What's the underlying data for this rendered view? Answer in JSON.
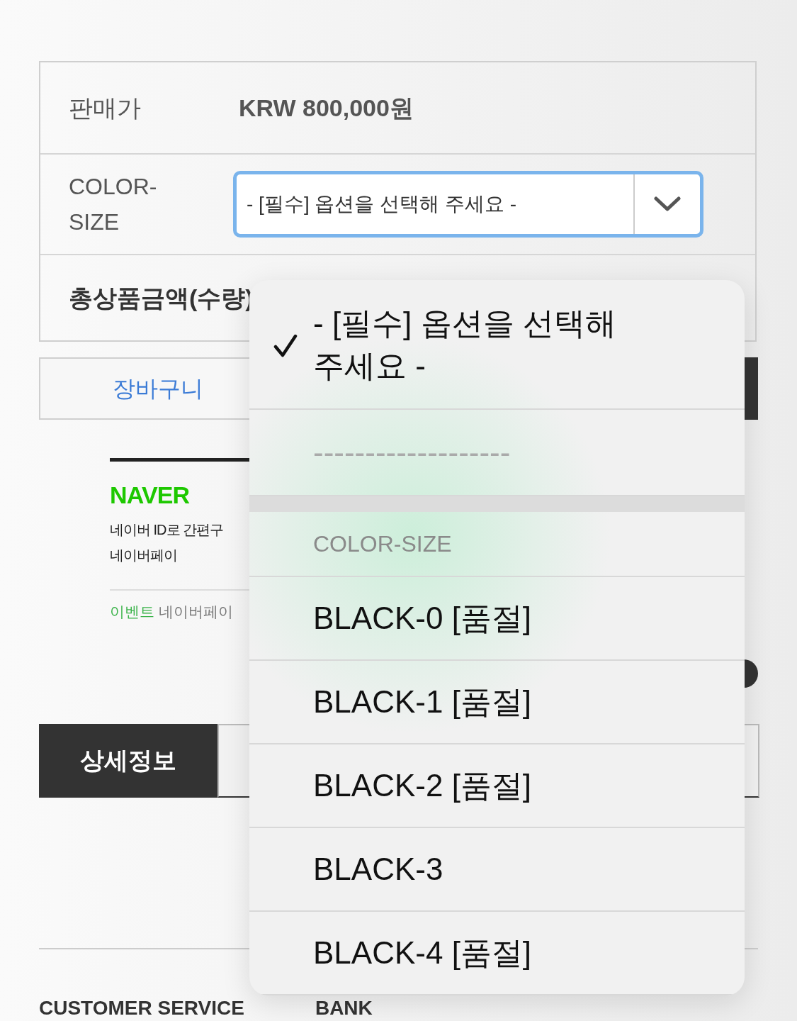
{
  "product_info": {
    "price_label": "판매가",
    "price": "KRW 800,000원",
    "option_label": "COLOR-SIZE",
    "select": {
      "value": "- [필수] 옵션을 선택해 주세요 -",
      "focused": true
    },
    "total_label": "총상품금액(수량)"
  },
  "actions": {
    "cart": "장바구니"
  },
  "naver_pay": {
    "logo": "NAVER",
    "lines": [
      "네이버 ID로 간편구",
      "네이버페이"
    ],
    "event_tag": "이벤트",
    "event_text": "네이버페이"
  },
  "tabs": [
    {
      "label": "상세정보",
      "selected": true
    },
    {
      "selected": false
    }
  ],
  "footer": [
    "CUSTOMER SERVICE",
    "BANK"
  ],
  "dropdown": {
    "items": [
      {
        "kind": "option",
        "label": "- [필수] 옵션을 선택해 주세요 -",
        "selected": true,
        "disabled": false
      },
      {
        "kind": "option",
        "label": "-------------------",
        "selected": false,
        "disabled": true
      },
      {
        "kind": "divider"
      },
      {
        "kind": "group",
        "label": "COLOR-SIZE"
      },
      {
        "kind": "option",
        "label": "BLACK-0 [품절]",
        "selected": false,
        "disabled": false
      },
      {
        "kind": "option",
        "label": "BLACK-1 [품절]",
        "selected": false,
        "disabled": false
      },
      {
        "kind": "option",
        "label": "BLACK-2 [품절]",
        "selected": false,
        "disabled": false
      },
      {
        "kind": "option",
        "label": "BLACK-3",
        "selected": false,
        "disabled": false
      },
      {
        "kind": "option",
        "label": "BLACK-4 [품절]",
        "selected": false,
        "disabled": false
      }
    ]
  }
}
